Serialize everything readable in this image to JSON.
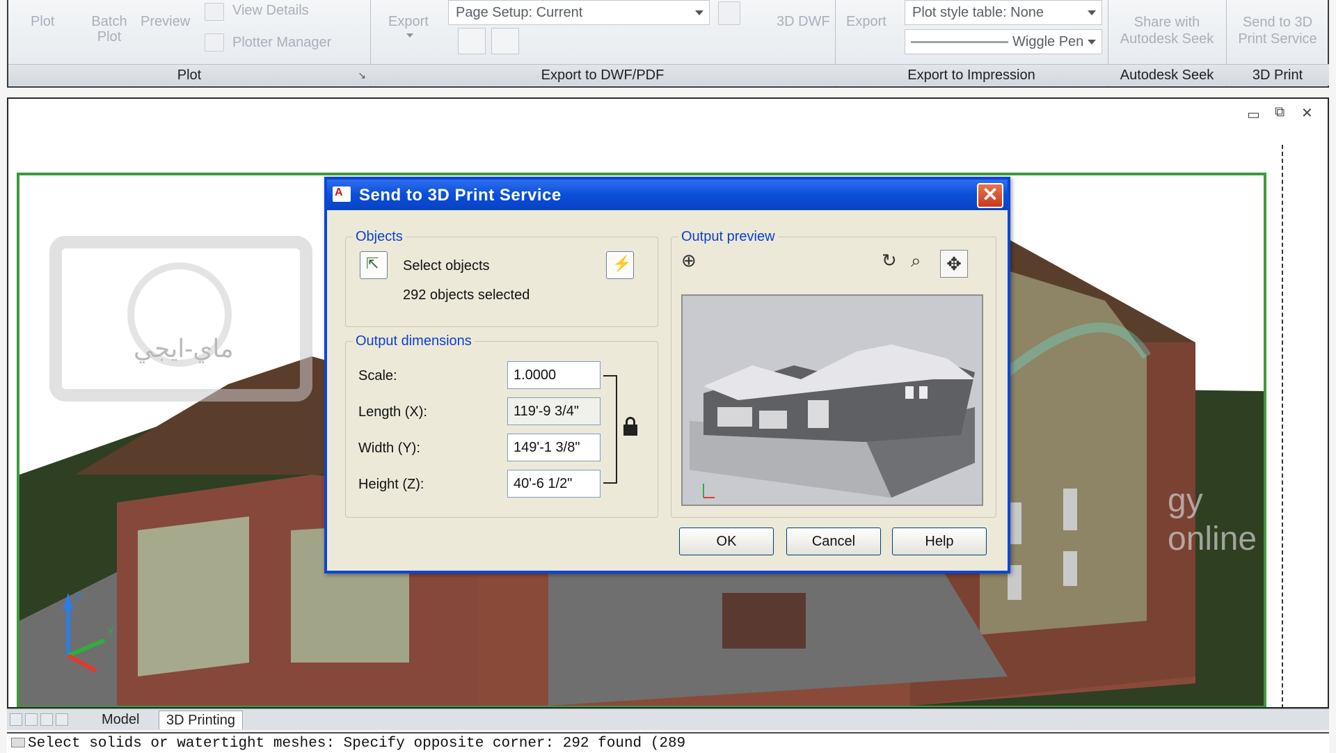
{
  "ribbon": {
    "plot_panel": {
      "title": "Plot",
      "items": [
        "Plot",
        "Batch\nPlot",
        "Preview"
      ],
      "view_details": "View Details",
      "plotter_manager": "Plotter Manager"
    },
    "export_panel": {
      "title": "Export to DWF/PDF",
      "export_label": "Export",
      "page_setup": "Page Setup: Current",
      "dwf_label": "3D DWF"
    },
    "impression_panel": {
      "title": "Export to Impression",
      "export_label": "Export",
      "plot_style": "Plot style table: None",
      "wiggle": "Wiggle Pen"
    },
    "seek_panel": {
      "title": "Autodesk Seek",
      "label": "Share with\nAutodesk Seek"
    },
    "print3d_panel": {
      "title": "3D Print",
      "label": "Send to 3D\nPrint Service"
    }
  },
  "layout_tabs": [
    "Model",
    "3D Printing"
  ],
  "command_line": "Select solids or watertight meshes: Specify opposite corner: 292 found (289",
  "dialog": {
    "title": "Send to 3D Print Service",
    "objects_group": "Objects",
    "select_objects": "Select objects",
    "selected_count": "292 objects selected",
    "dimensions_group": "Output dimensions",
    "fields": [
      {
        "label": "Scale:",
        "value": "1.0000"
      },
      {
        "label": "Length (X):",
        "value": "119'-9 3/4\""
      },
      {
        "label": "Width (Y):",
        "value": "149'-1 3/8\""
      },
      {
        "label": "Height (Z):",
        "value": "40'-6 1/2\""
      }
    ],
    "preview_group": "Output preview",
    "buttons": {
      "ok": "OK",
      "cancel": "Cancel",
      "help": "Help"
    }
  },
  "watermark": {
    "text": "ماي-ايجي",
    "latin": "gy online"
  },
  "colors": {
    "title_blue": "#0a4fd8",
    "scene_green": "#3c9a3c",
    "legend_blue": "#0b3fcf"
  }
}
